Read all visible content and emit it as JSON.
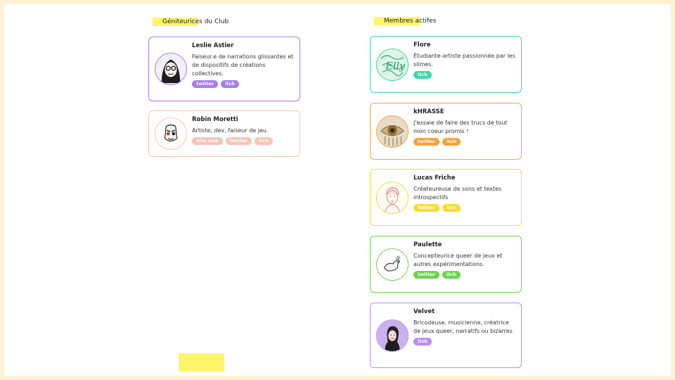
{
  "sections": {
    "founders_title": "Géniteurices du Club",
    "members_title": "Membres actifes"
  },
  "founders": [
    {
      "name": "Leslie Astier",
      "desc": "Faiseur.e de narrations glissantes et de dispositifs de créations collectives.",
      "tags": [
        "twitter",
        "itch"
      ],
      "color": "#a77cf0",
      "avatar": "portrait-leslie-icon"
    },
    {
      "name": "Robin Moretti",
      "desc": "Artiste, dev, faiseur de jeu",
      "tags": [
        "Site web",
        "twitter",
        "itch"
      ],
      "color": "#f7c4b6",
      "avatar": "mask-robin-icon"
    }
  ],
  "members": [
    {
      "name": "Flore",
      "desc": "Étudiante-artiste passionnée par les slimes.",
      "tags": [
        "itch"
      ],
      "color": "#3ed6a8",
      "avatar": "slime-flore-icon"
    },
    {
      "name": "kHRASSE",
      "desc": "J'essaie de faire des trucs de tout mon coeur promis !",
      "tags": [
        "twitter",
        "itch"
      ],
      "color": "#f5a23c",
      "avatar": "eye-khrasse-icon"
    },
    {
      "name": "Lucas Friche",
      "desc": "Créateureuse de sons et textes introspectifs",
      "tags": [
        "twitter",
        "itch"
      ],
      "color": "#fbdc2c",
      "avatar": "portrait-lucas-icon"
    },
    {
      "name": "Paulette",
      "desc": "Concepteurice queer de jeux et autres expérimentations.",
      "tags": [
        "twitter",
        "itch"
      ],
      "color": "#6cd44c",
      "avatar": "bird-paulette-icon"
    },
    {
      "name": "Velvet",
      "desc": "Bricodeuse, musicienne, créatrice de jeux queer, narratifs ou bizarres",
      "tags": [
        "itch"
      ],
      "color": "#b88cf0",
      "avatar": "portrait-velvet-icon"
    }
  ],
  "colors": {
    "background": "#fdf3d4",
    "highlight": "#fff56a"
  }
}
